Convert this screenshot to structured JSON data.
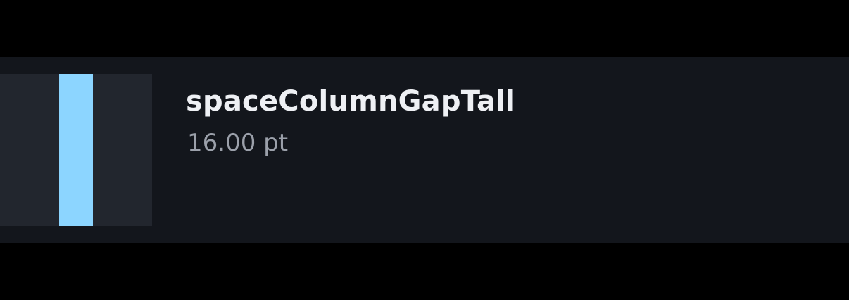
{
  "token": {
    "name": "spaceColumnGapTall",
    "value": "16.00 pt"
  },
  "colors": {
    "background": "#000000",
    "row": "#13161c",
    "preview": "#22262e",
    "gap_highlight": "#8cd5ff",
    "name_text": "#eef0f4",
    "value_text": "#9ba0aa"
  }
}
